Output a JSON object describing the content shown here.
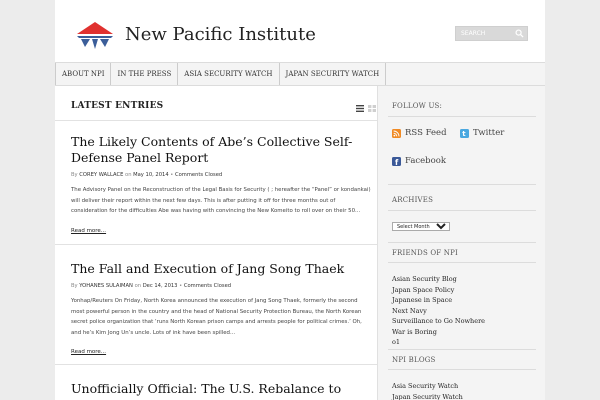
{
  "header": {
    "site_title": "New Pacific Institute",
    "search_placeholder": "SEARCH",
    "logo_colors": {
      "red": "#e0312f",
      "blue": "#3b5e9a"
    }
  },
  "nav": {
    "items": [
      {
        "label": "ABOUT NPI"
      },
      {
        "label": "IN THE PRESS"
      },
      {
        "label": "ASIA SECURITY WATCH"
      },
      {
        "label": "JAPAN SECURITY WATCH"
      }
    ]
  },
  "main": {
    "heading": "LATEST ENTRIES",
    "posts": [
      {
        "title": "The Likely Contents of Abe’s Collective Self-Defense Panel Report",
        "by": "By",
        "author": "COREY WALLACE",
        "on": "on",
        "date": "May 10, 2014",
        "sep": "•",
        "comments": "Comments Closed",
        "excerpt": "The Advisory Panel on the Reconstruction of the Legal Basis for Security (                  ; hereafter the “Panel” or kondankai) will deliver their report within the next few days. This is after putting it off for three months out of consideration for the difficulties Abe was having with convincing the New Komeito to roll over on their 50...",
        "read_more": "Read more..."
      },
      {
        "title": "The Fall and Execution of Jang Song Thaek",
        "by": "By",
        "author": "YOHANES SULAIMAN",
        "on": "on",
        "date": "Dec 14, 2013",
        "sep": "•",
        "comments": "Comments Closed",
        "excerpt": "Yonhap/Reuters On Friday, North Korea announced the execution of Jang Song Thaek, formerly the second most powerful person in the country and the head of National Security Protection Bureau, the North Korean secret police organization that ‘runs North Korean prison camps and arrests people for political crimes.’ Oh, and he’s Kim Jong Un’s uncle. Lots of ink have been spilled...",
        "read_more": "Read more..."
      },
      {
        "title": "Unofficially Official: The U.S. Rebalance to Asia-Pacific and the U.S.-Japan Tri-",
        "by": "",
        "author": "",
        "on": "",
        "date": "",
        "sep": "",
        "comments": "",
        "excerpt": "",
        "read_more": ""
      }
    ]
  },
  "sidebar": {
    "follow_heading": "FOLLOW US:",
    "follow": {
      "rss": "RSS Feed",
      "twitter": "Twitter",
      "facebook": "Facebook"
    },
    "archives_heading": "ARCHIVES",
    "archives_select": "Select Month",
    "friends_heading": "FRIENDS OF NPI",
    "friends": [
      "Asian Security Blog",
      "Japan Space Policy",
      "Japanese in Space",
      "Next Navy",
      "Surveillance to Go Nowhere",
      "War is Boring",
      "o1"
    ],
    "blogs_heading": "NPI BLOGS",
    "blogs": [
      "Asia Security Watch",
      "Japan Security Watch"
    ]
  }
}
